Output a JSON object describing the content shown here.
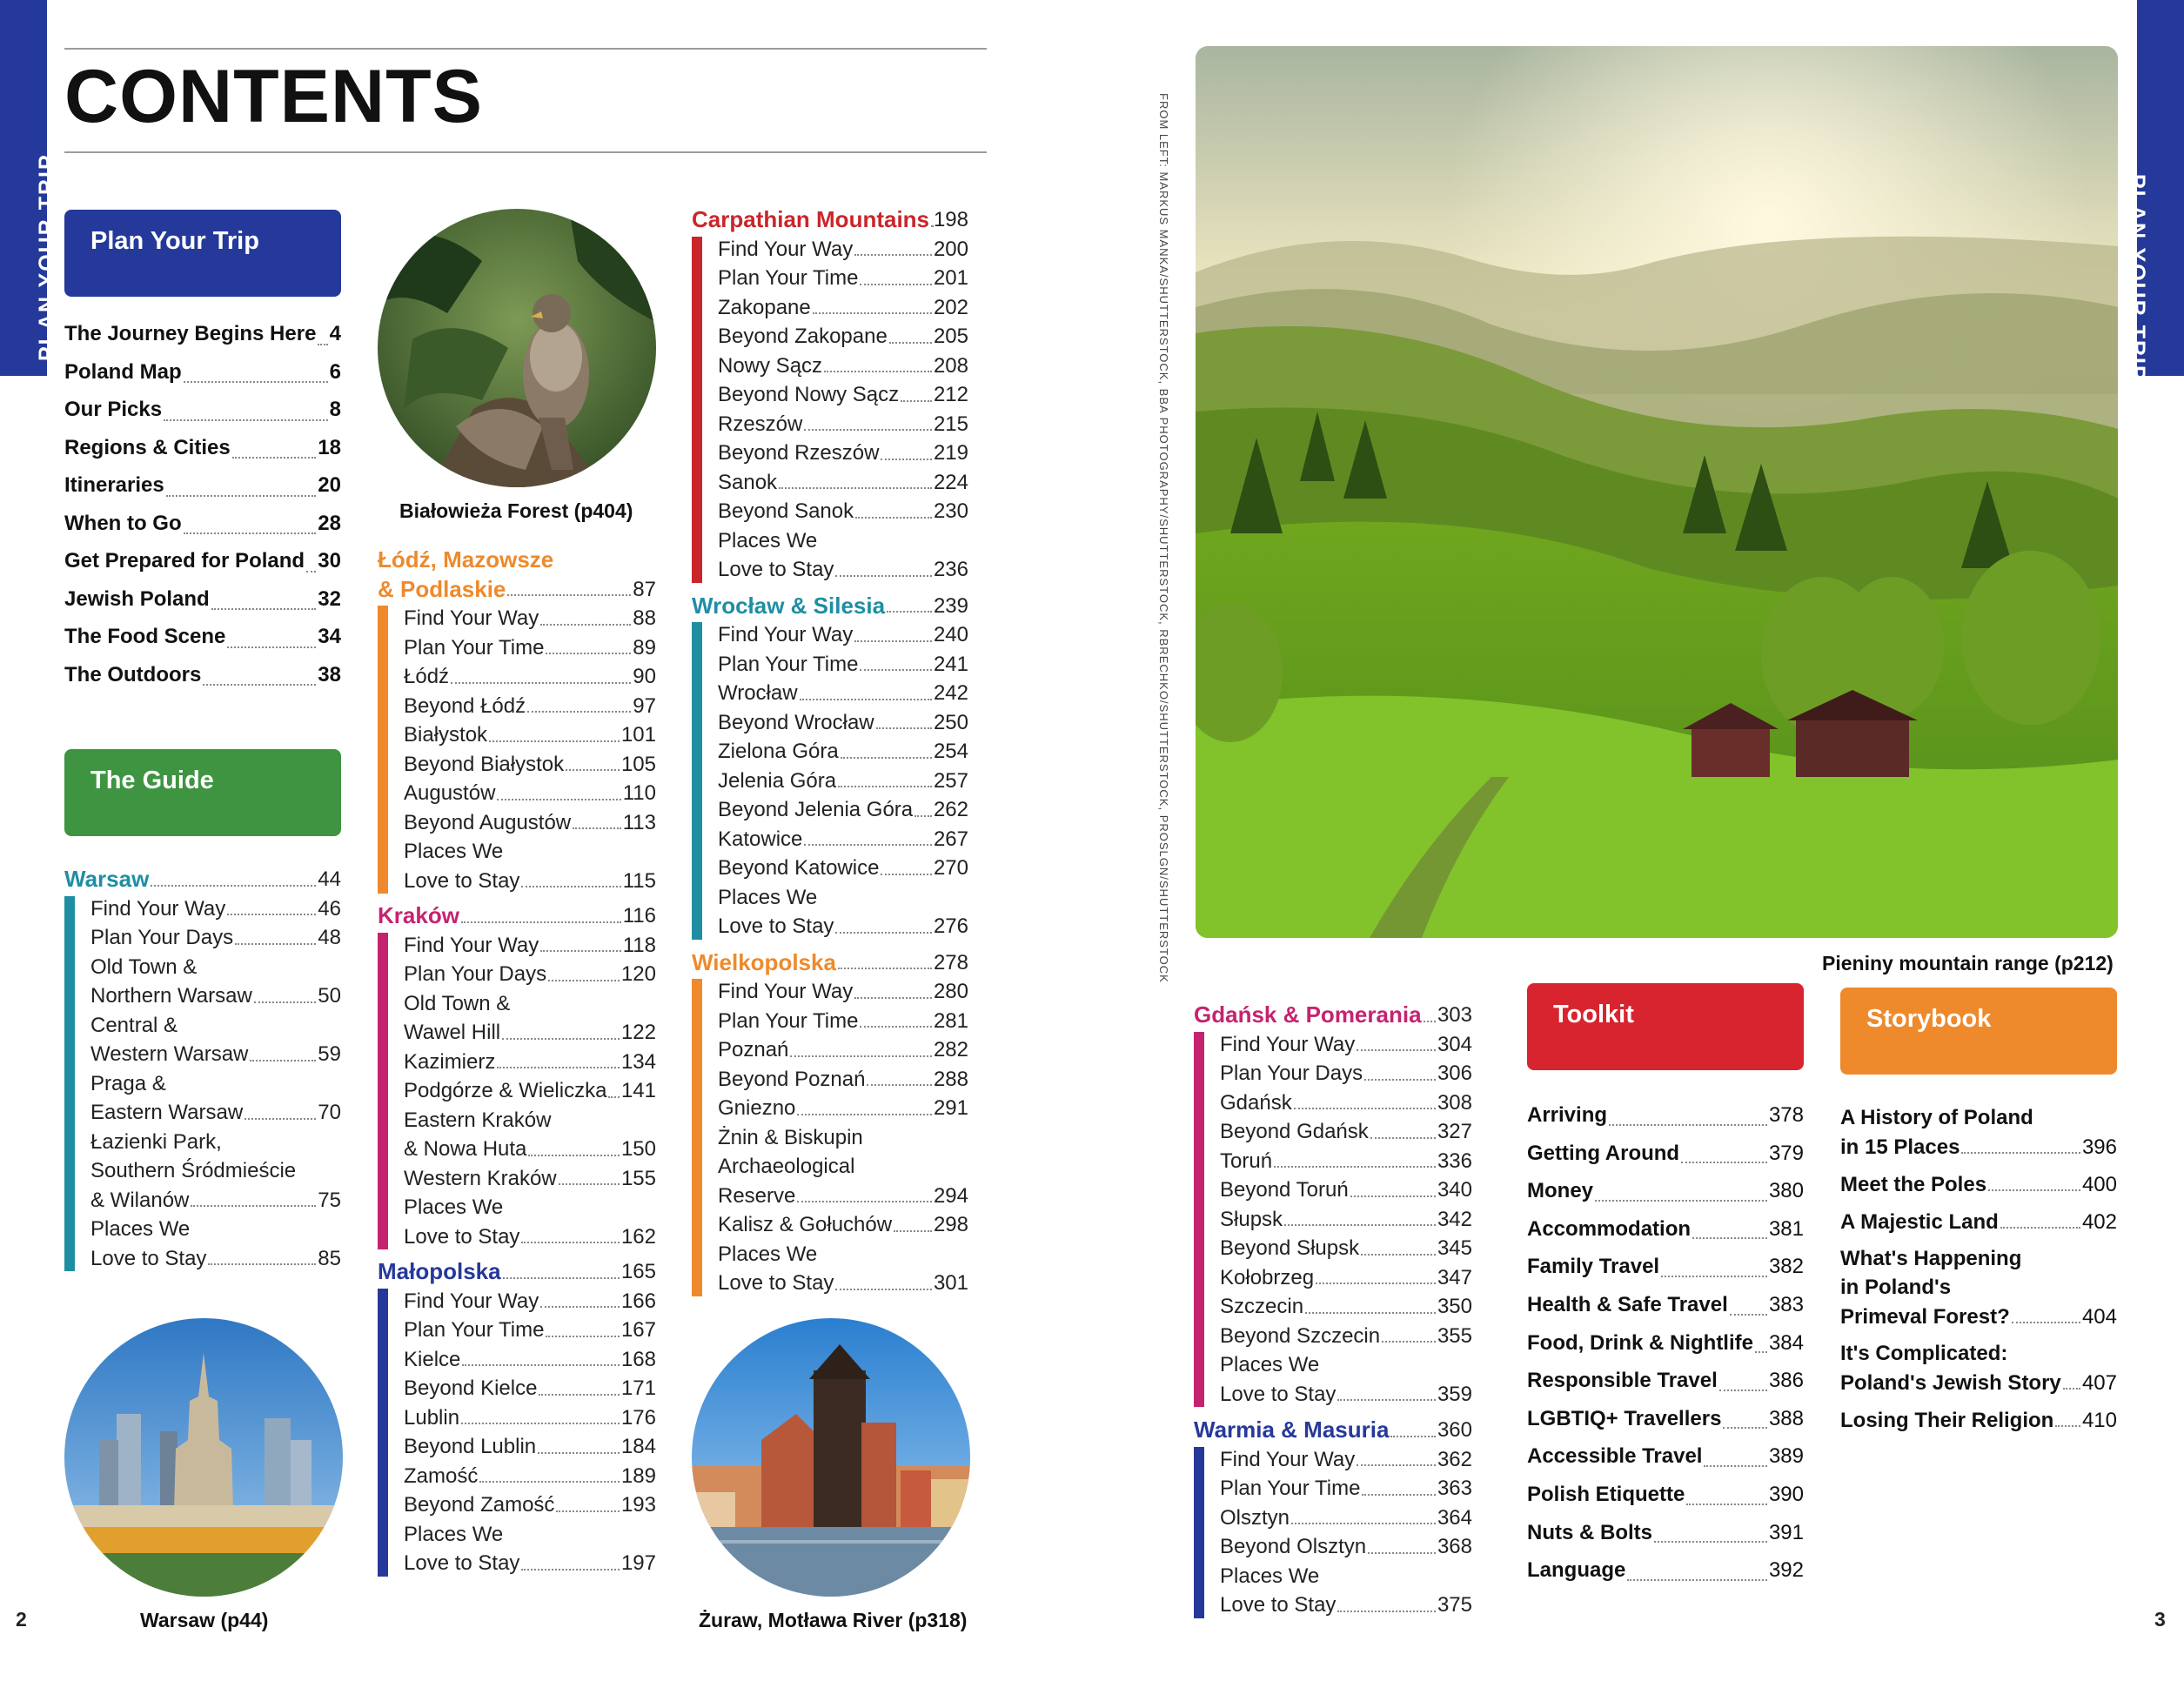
{
  "side_tab": "PLAN YOUR TRIP",
  "page_title": "CONTENTS",
  "boxes": {
    "plan": "Plan Your Trip",
    "guide": "The Guide",
    "toolkit": "Toolkit",
    "storybook": "Storybook"
  },
  "colors": {
    "blue": "#24399a",
    "green": "#3e9441",
    "teal": "#1f8ea3",
    "orange": "#ee8a2c",
    "pink": "#d0267a",
    "red": "#d8242f",
    "navy": "#26399a",
    "crimson": "#c9262b",
    "magenta": "#c52370"
  },
  "plan_items": [
    {
      "label": "The Journey Begins Here",
      "page": "4"
    },
    {
      "label": "Poland Map",
      "page": "6"
    },
    {
      "label": "Our Picks",
      "page": "8"
    },
    {
      "label": "Regions & Cities",
      "page": "18"
    },
    {
      "label": "Itineraries",
      "page": "20"
    },
    {
      "label": "When to Go",
      "page": "28"
    },
    {
      "label": "Get Prepared for Poland",
      "page": "30"
    },
    {
      "label": "Jewish Poland",
      "page": "32"
    },
    {
      "label": "The Food Scene",
      "page": "34"
    },
    {
      "label": "The Outdoors",
      "page": "38"
    }
  ],
  "warsaw": {
    "title": "Warsaw",
    "page": "44",
    "items": [
      {
        "l1": "Find Your Way",
        "page": "46"
      },
      {
        "l1": "Plan Your Days",
        "page": "48"
      },
      {
        "l0": "Old Town &",
        "l1": "Northern Warsaw",
        "page": "50"
      },
      {
        "l0": "Central &",
        "l1": "Western Warsaw",
        "page": "59"
      },
      {
        "l0": "Praga &",
        "l1": "Eastern Warsaw",
        "page": "70"
      },
      {
        "l0a": "Łazienki Park,",
        "l0": "Southern Śródmieście",
        "l1": "& Wilanów",
        "page": "75"
      },
      {
        "l0": "Places We",
        "l1": "Love to Stay",
        "page": "85"
      }
    ]
  },
  "lodz": {
    "title1": "Łódź, Mazowsze",
    "title2": "& Podlaskie",
    "page": "87",
    "items": [
      {
        "l1": "Find Your Way",
        "page": "88"
      },
      {
        "l1": "Plan Your Time",
        "page": "89"
      },
      {
        "l1": "Łódź",
        "page": "90"
      },
      {
        "l1": "Beyond Łódź",
        "page": "97"
      },
      {
        "l1": "Białystok",
        "page": "101"
      },
      {
        "l1": "Beyond Białystok",
        "page": "105"
      },
      {
        "l1": "Augustów",
        "page": "110"
      },
      {
        "l1": "Beyond Augustów",
        "page": "113"
      },
      {
        "l0": "Places We",
        "l1": "Love to Stay",
        "page": "115"
      }
    ]
  },
  "krakow": {
    "title": "Kraków",
    "page": "116",
    "items": [
      {
        "l1": "Find Your Way",
        "page": "118"
      },
      {
        "l1": "Plan Your Days",
        "page": "120"
      },
      {
        "l0": "Old Town &",
        "l1": "Wawel Hill",
        "page": "122"
      },
      {
        "l1": "Kazimierz",
        "page": "134"
      },
      {
        "l1": "Podgórze & Wieliczka",
        "page": "141"
      },
      {
        "l0": "Eastern Kraków",
        "l1": "& Nowa Huta",
        "page": "150"
      },
      {
        "l1": "Western Kraków",
        "page": "155"
      },
      {
        "l0": "Places We",
        "l1": "Love to Stay",
        "page": "162"
      }
    ]
  },
  "malopolska": {
    "title": "Małopolska",
    "page": "165",
    "items": [
      {
        "l1": "Find Your Way",
        "page": "166"
      },
      {
        "l1": "Plan Your Time",
        "page": "167"
      },
      {
        "l1": "Kielce",
        "page": "168"
      },
      {
        "l1": "Beyond Kielce",
        "page": "171"
      },
      {
        "l1": "Lublin",
        "page": "176"
      },
      {
        "l1": "Beyond Lublin",
        "page": "184"
      },
      {
        "l1": "Zamość",
        "page": "189"
      },
      {
        "l1": "Beyond Zamość",
        "page": "193"
      },
      {
        "l0": "Places We",
        "l1": "Love to Stay",
        "page": "197"
      }
    ]
  },
  "carpathian": {
    "title": "Carpathian Mountains",
    "page": "198",
    "items": [
      {
        "l1": "Find Your Way",
        "page": "200"
      },
      {
        "l1": "Plan Your Time",
        "page": "201"
      },
      {
        "l1": "Zakopane",
        "page": "202"
      },
      {
        "l1": "Beyond Zakopane",
        "page": "205"
      },
      {
        "l1": "Nowy Sącz",
        "page": "208"
      },
      {
        "l1": "Beyond Nowy Sącz",
        "page": "212"
      },
      {
        "l1": "Rzeszów",
        "page": "215"
      },
      {
        "l1": "Beyond Rzeszów",
        "page": "219"
      },
      {
        "l1": "Sanok",
        "page": "224"
      },
      {
        "l1": "Beyond Sanok",
        "page": "230"
      },
      {
        "l0": "Places We",
        "l1": "Love to Stay",
        "page": "236"
      }
    ]
  },
  "wroclaw": {
    "title": "Wrocław & Silesia",
    "page": "239",
    "items": [
      {
        "l1": "Find Your Way",
        "page": "240"
      },
      {
        "l1": "Plan Your Time",
        "page": "241"
      },
      {
        "l1": "Wrocław",
        "page": "242"
      },
      {
        "l1": "Beyond Wrocław",
        "page": "250"
      },
      {
        "l1": "Zielona Góra",
        "page": "254"
      },
      {
        "l1": "Jelenia Góra",
        "page": "257"
      },
      {
        "l1": "Beyond Jelenia Góra",
        "page": "262"
      },
      {
        "l1": "Katowice",
        "page": "267"
      },
      {
        "l1": "Beyond Katowice",
        "page": "270"
      },
      {
        "l0": "Places We",
        "l1": "Love to Stay",
        "page": "276"
      }
    ]
  },
  "wielkopolska": {
    "title": "Wielkopolska",
    "page": "278",
    "items": [
      {
        "l1": "Find Your Way",
        "page": "280"
      },
      {
        "l1": "Plan Your Time",
        "page": "281"
      },
      {
        "l1": "Poznań",
        "page": "282"
      },
      {
        "l1": "Beyond Poznań",
        "page": "288"
      },
      {
        "l1": "Gniezno",
        "page": "291"
      },
      {
        "l0": "Żnin & Biskupin",
        "l0b": "Archaeological",
        "l1": "Reserve",
        "page": "294"
      },
      {
        "l1": "Kalisz & Gołuchów",
        "page": "298"
      },
      {
        "l0": "Places We",
        "l1": "Love to Stay",
        "page": "301"
      }
    ]
  },
  "gdansk": {
    "title": "Gdańsk & Pomerania",
    "page": "303",
    "items": [
      {
        "l1": "Find Your Way",
        "page": "304"
      },
      {
        "l1": "Plan Your Days",
        "page": "306"
      },
      {
        "l1": "Gdańsk",
        "page": "308"
      },
      {
        "l1": "Beyond Gdańsk",
        "page": "327"
      },
      {
        "l1": "Toruń",
        "page": "336"
      },
      {
        "l1": "Beyond Toruń",
        "page": "340"
      },
      {
        "l1": "Słupsk",
        "page": "342"
      },
      {
        "l1": "Beyond Słupsk",
        "page": "345"
      },
      {
        "l1": "Kołobrzeg",
        "page": "347"
      },
      {
        "l1": "Szczecin",
        "page": "350"
      },
      {
        "l1": "Beyond Szczecin",
        "page": "355"
      },
      {
        "l0": "Places We",
        "l1": "Love to Stay",
        "page": "359"
      }
    ]
  },
  "warmia": {
    "title": "Warmia & Masuria",
    "page": "360",
    "items": [
      {
        "l1": "Find Your Way",
        "page": "362"
      },
      {
        "l1": "Plan Your Time",
        "page": "363"
      },
      {
        "l1": "Olsztyn",
        "page": "364"
      },
      {
        "l1": "Beyond Olsztyn",
        "page": "368"
      },
      {
        "l0": "Places We",
        "l1": "Love to Stay",
        "page": "375"
      }
    ]
  },
  "toolkit_items": [
    {
      "label": "Arriving",
      "page": "378"
    },
    {
      "label": "Getting Around",
      "page": "379"
    },
    {
      "label": "Money",
      "page": "380"
    },
    {
      "label": "Accommodation",
      "page": "381"
    },
    {
      "label": "Family Travel",
      "page": "382"
    },
    {
      "label": "Health & Safe Travel",
      "page": "383"
    },
    {
      "label": "Food, Drink & Nightlife",
      "page": "384"
    },
    {
      "label": "Responsible Travel",
      "page": "386"
    },
    {
      "label": "LGBTIQ+ Travellers",
      "page": "388"
    },
    {
      "label": "Accessible Travel",
      "page": "389"
    },
    {
      "label": "Polish Etiquette",
      "page": "390"
    },
    {
      "label": "Nuts & Bolts",
      "page": "391"
    },
    {
      "label": "Language",
      "page": "392"
    }
  ],
  "storybook_items": [
    {
      "l0": "A History of Poland",
      "l1": "in 15 Places",
      "page": "396"
    },
    {
      "l1": "Meet the Poles",
      "page": "400"
    },
    {
      "l1": "A Majestic Land",
      "page": "402"
    },
    {
      "l0": "What's Happening",
      "l0b": "in Poland's",
      "l1": "Primeval Forest?",
      "page": "404"
    },
    {
      "l0": "It's Complicated:",
      "l1": "Poland's Jewish Story",
      "page": "407"
    },
    {
      "l1": "Losing Their Religion",
      "page": "410"
    }
  ],
  "captions": {
    "bialowieza": "Białowieża Forest (p404)",
    "warsaw": "Warsaw (p44)",
    "zuraw": "Żuraw, Motława River (p318)",
    "pieniny": "Pieniny mountain range (p212)"
  },
  "credit": "FROM LEFT: MARKUS MANKA/SHUTTERSTOCK, BBA PHOTOGRAPHY/SHUTTERSTOCK, RBRECHKO/SHUTTERSTOCK, PROSLGN/SHUTTERSTOCK",
  "page_numbers": {
    "left": "2",
    "right": "3"
  }
}
